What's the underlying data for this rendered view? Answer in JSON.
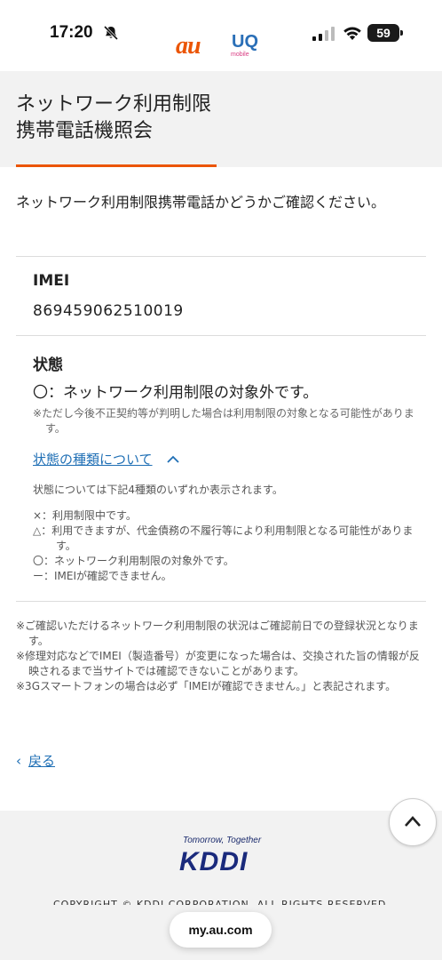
{
  "status_bar": {
    "time": "17:20",
    "battery": "59"
  },
  "brand": {
    "au": "au",
    "uq": "UQ",
    "uq_sub": "mobile"
  },
  "header": {
    "title_line1": "ネットワーク利用制限",
    "title_line2": "携帯電話機照会"
  },
  "intro": "ネットワーク利用制限携帯電話かどうかご確認ください。",
  "imei": {
    "label": "IMEI",
    "value": "869459062510019"
  },
  "state": {
    "label": "状態",
    "result": "〇：ネットワーク利用制限の対象外です。",
    "note": "※ただし今後不正契約等が判明した場合は利用制限の対象となる可能性があります。"
  },
  "state_types": {
    "link": "状態の種類について",
    "intro": "状態については下記4種類のいずれか表示されます。",
    "items": [
      "×：利用制限中です。",
      "△：利用できますが、代金債務の不履行等により利用制限となる可能性があります。",
      "〇：ネットワーク利用制限の対象外です。",
      "ー：IMEIが確認できません。"
    ]
  },
  "notes": [
    "※ご確認いただけるネットワーク利用制限の状況はご確認前日での登録状況となります。",
    "※修理対応などでIMEI（製造番号）が変更になった場合は、交換された旨の情報が反映されるまで当サイトでは確認できないことがあります。",
    "※3Gスマートフォンの場合は必ず「IMEIが確認できません。」と表記されます。"
  ],
  "back": "戻る",
  "footer": {
    "tagline": "Tomorrow, Together",
    "logo": "KDDI",
    "copyright": "COPYRIGHT © KDDI CORPORATION. ALL RIGHTS RESERVED."
  },
  "browser": {
    "url": "my.au.com"
  },
  "colors": {
    "accent": "#eb5505",
    "link": "#1f6fb5",
    "kddi": "#1a2a7c"
  }
}
